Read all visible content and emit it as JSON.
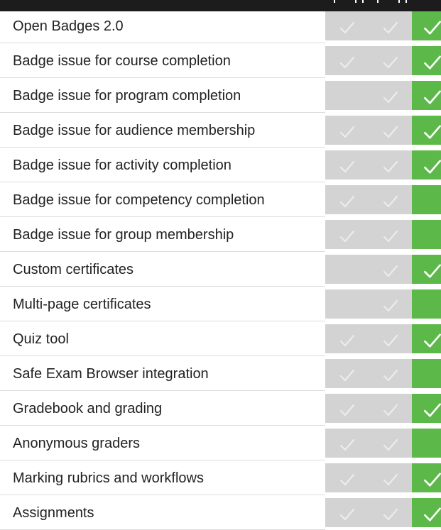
{
  "colors": {
    "header": "#1c1c1c",
    "plan_a": "#d3d3d3",
    "plan_b": "#d3d3d3",
    "plan_c": "#5cb849"
  },
  "rows": [
    {
      "label": "Open Badges 2.0",
      "checks": [
        true,
        true,
        true
      ]
    },
    {
      "label": "Badge issue for course completion",
      "checks": [
        true,
        true,
        true
      ]
    },
    {
      "label": "Badge issue for program completion",
      "checks": [
        false,
        true,
        true
      ]
    },
    {
      "label": "Badge issue for audience membership",
      "checks": [
        true,
        true,
        true
      ]
    },
    {
      "label": "Badge issue for activity completion",
      "checks": [
        true,
        true,
        true
      ]
    },
    {
      "label": "Badge issue for competency completion",
      "checks": [
        true,
        true,
        false
      ]
    },
    {
      "label": "Badge issue for group membership",
      "checks": [
        true,
        true,
        false
      ]
    },
    {
      "label": "Custom certificates",
      "checks": [
        false,
        true,
        true
      ]
    },
    {
      "label": "Multi-page certificates",
      "checks": [
        false,
        true,
        false
      ]
    },
    {
      "label": "Quiz tool",
      "checks": [
        true,
        true,
        true
      ]
    },
    {
      "label": "Safe Exam Browser integration",
      "checks": [
        true,
        true,
        false
      ]
    },
    {
      "label": "Gradebook and grading",
      "checks": [
        true,
        true,
        true
      ]
    },
    {
      "label": "Anonymous graders",
      "checks": [
        true,
        true,
        false
      ]
    },
    {
      "label": "Marking rubrics and workflows",
      "checks": [
        true,
        true,
        true
      ]
    },
    {
      "label": "Assignments",
      "checks": [
        true,
        true,
        true
      ]
    }
  ]
}
